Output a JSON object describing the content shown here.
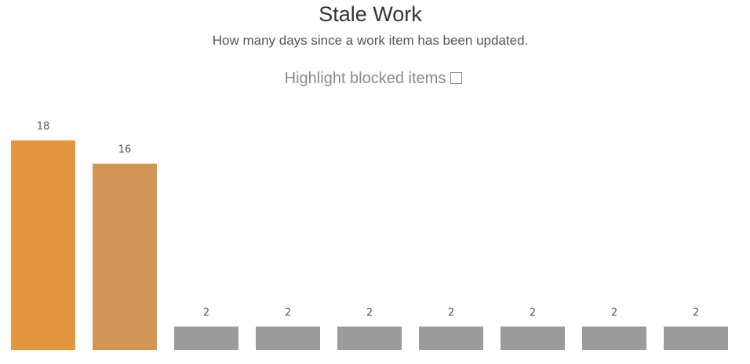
{
  "title": "Stale Work",
  "subtitle": "How many days since a work item has been updated.",
  "toggle": {
    "label": "Highlight blocked items",
    "checked": false
  },
  "chart_data": {
    "type": "bar",
    "title": "Stale Work",
    "subtitle": "How many days since a work item has been updated.",
    "categories": [
      "",
      "",
      "",
      "",
      "",
      "",
      "",
      "",
      ""
    ],
    "values": [
      18,
      16,
      2,
      2,
      2,
      2,
      2,
      2,
      2
    ],
    "colors": [
      "#E4963F",
      "#D19655",
      "#9B9B9B",
      "#9B9B9B",
      "#9B9B9B",
      "#9B9B9B",
      "#9B9B9B",
      "#9B9B9B",
      "#9B9B9B"
    ],
    "data_labels": true,
    "xlabel": "",
    "ylabel": "",
    "ylim": [
      0,
      18
    ],
    "grid": false,
    "legend": "none"
  }
}
